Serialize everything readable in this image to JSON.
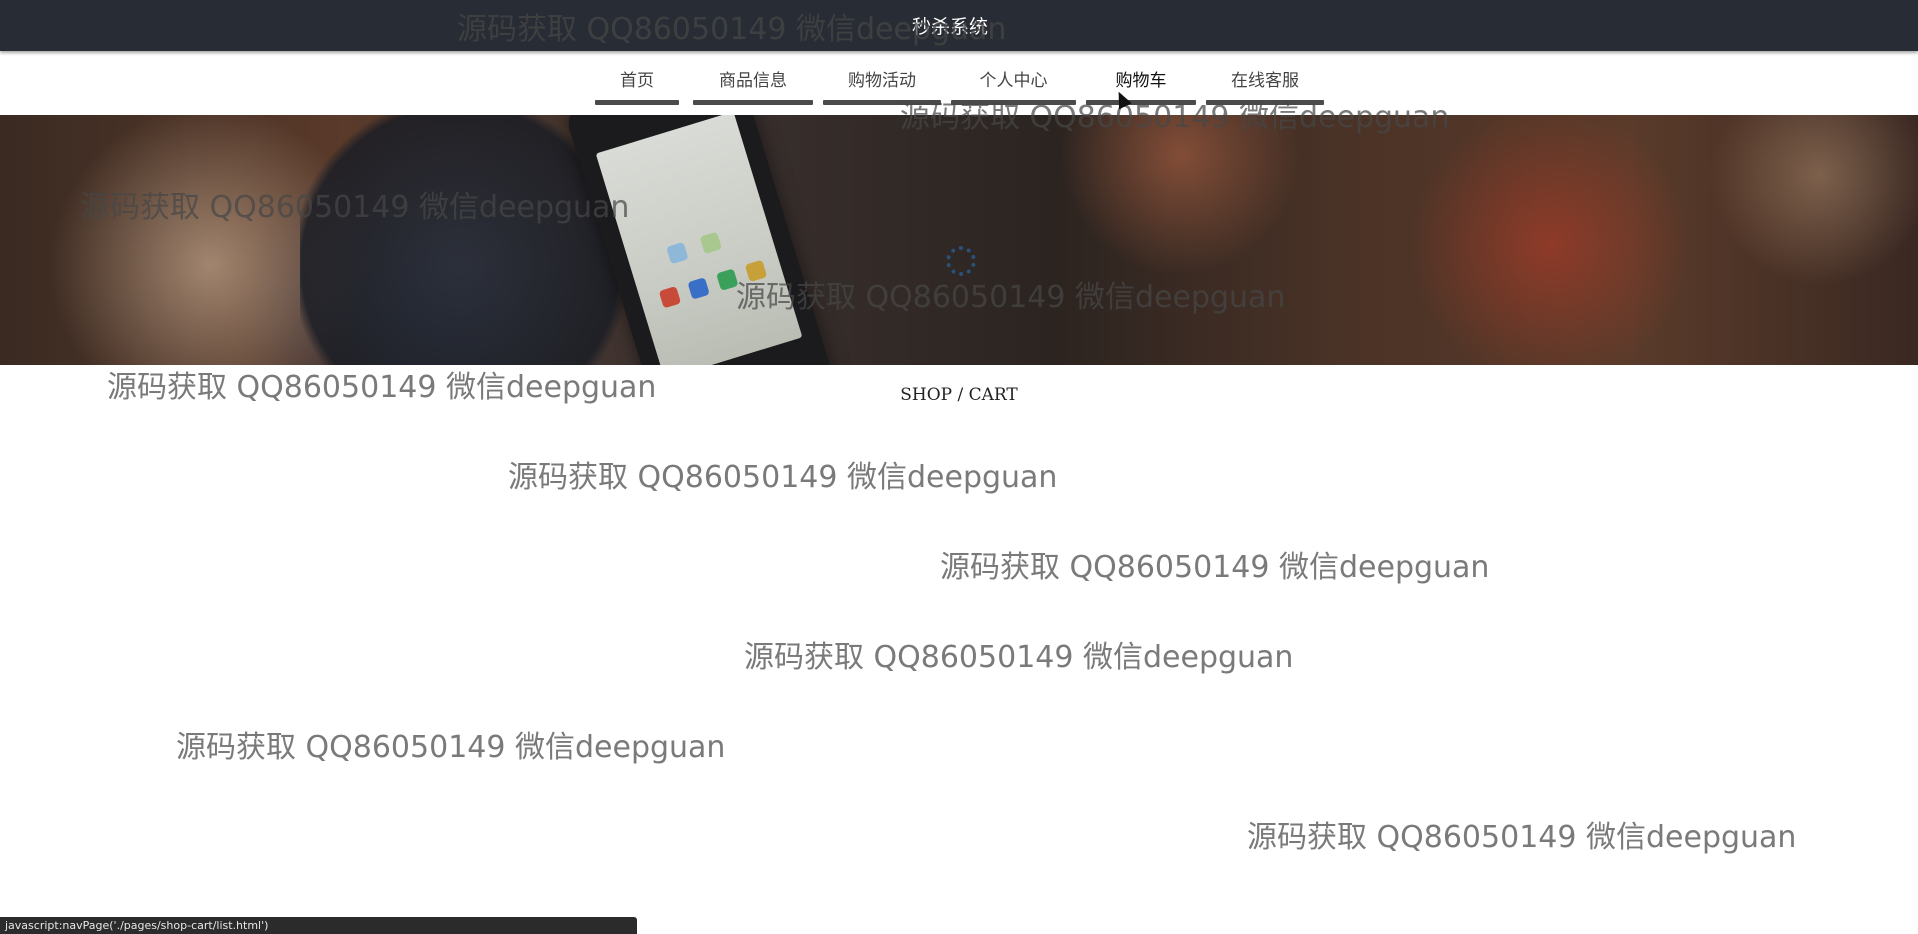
{
  "header": {
    "title": "秒杀系统"
  },
  "nav": {
    "items": [
      {
        "label": "首页"
      },
      {
        "label": "商品信息"
      },
      {
        "label": "购物活动"
      },
      {
        "label": "个人中心"
      },
      {
        "label": "购物车"
      },
      {
        "label": "在线客服"
      }
    ],
    "active": "购物车"
  },
  "breadcrumb": "SHOP / CART",
  "watermark_text": "源码获取 QQ86050149 微信deepguan",
  "status_url": "javascript:navPage('./pages/shop-cart/list.html')",
  "colors": {
    "topbar": "#282c34",
    "nav_bar": "#4a4a4a",
    "spinner": "#29527a"
  }
}
